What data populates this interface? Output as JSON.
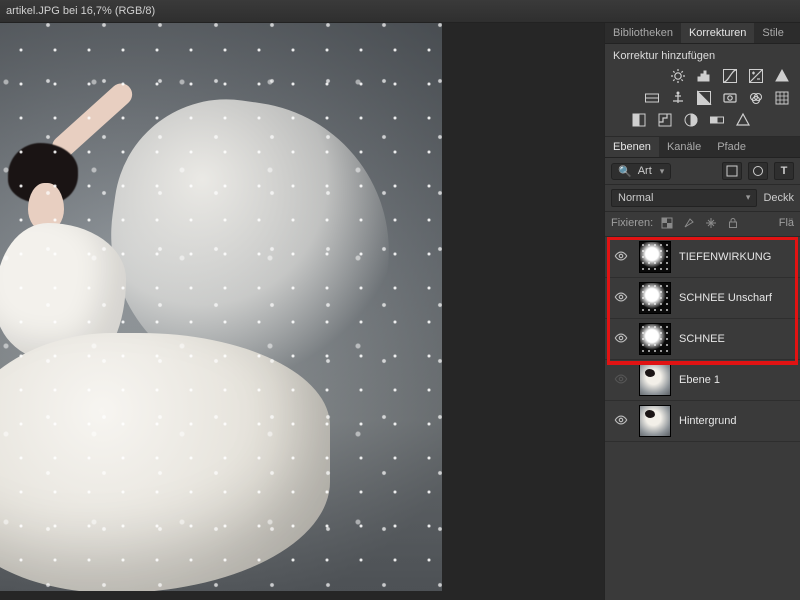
{
  "title_bar": "artikel.JPG bei 16,7% (RGB/8)",
  "right_panel": {
    "tabs": {
      "bibliotheken": "Bibliotheken",
      "korrekturen": "Korrekturen",
      "stile": "Stile",
      "active": 1
    },
    "add_label": "Korrektur hinzufügen"
  },
  "layers_panel": {
    "tabs": {
      "ebenen": "Ebenen",
      "kanaele": "Kanäle",
      "pfade": "Pfade",
      "active": 0
    },
    "kind_filter": "Art",
    "blend_mode": "Normal",
    "opacity_label": "Deckk",
    "lock_label": "Fixieren:",
    "fill_label": "Flä"
  },
  "layers": [
    {
      "name": "TIEFENWIRKUNG",
      "visible": true,
      "thumb": "snowy"
    },
    {
      "name": "SCHNEE Unscharf",
      "visible": true,
      "thumb": "snowy"
    },
    {
      "name": "SCHNEE",
      "visible": true,
      "thumb": "snowy"
    },
    {
      "name": "Ebene 1",
      "visible": false,
      "thumb": "photo"
    },
    {
      "name": "Hintergrund",
      "visible": true,
      "thumb": "photo"
    }
  ],
  "highlight": {
    "top": 0,
    "height": 121
  }
}
